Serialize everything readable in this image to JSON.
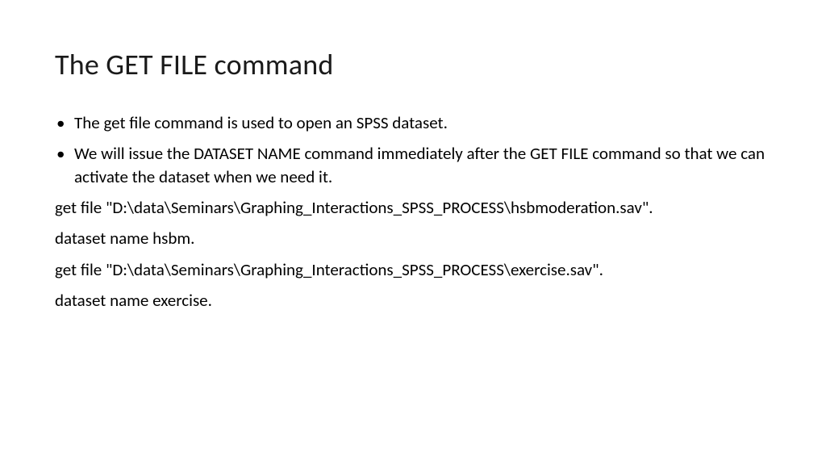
{
  "title": "The GET FILE command",
  "bullets": [
    "The get file command is used to open an SPSS dataset.",
    "We will issue the DATASET NAME command immediately after the GET FILE command so that we can activate the dataset when we need it."
  ],
  "code": [
    "get file \"D:\\data\\Seminars\\Graphing_Interactions_SPSS_PROCESS\\hsbmoderation.sav\".",
    "dataset name hsbm.",
    "get file \"D:\\data\\Seminars\\Graphing_Interactions_SPSS_PROCESS\\exercise.sav\".",
    "dataset name exercise."
  ]
}
